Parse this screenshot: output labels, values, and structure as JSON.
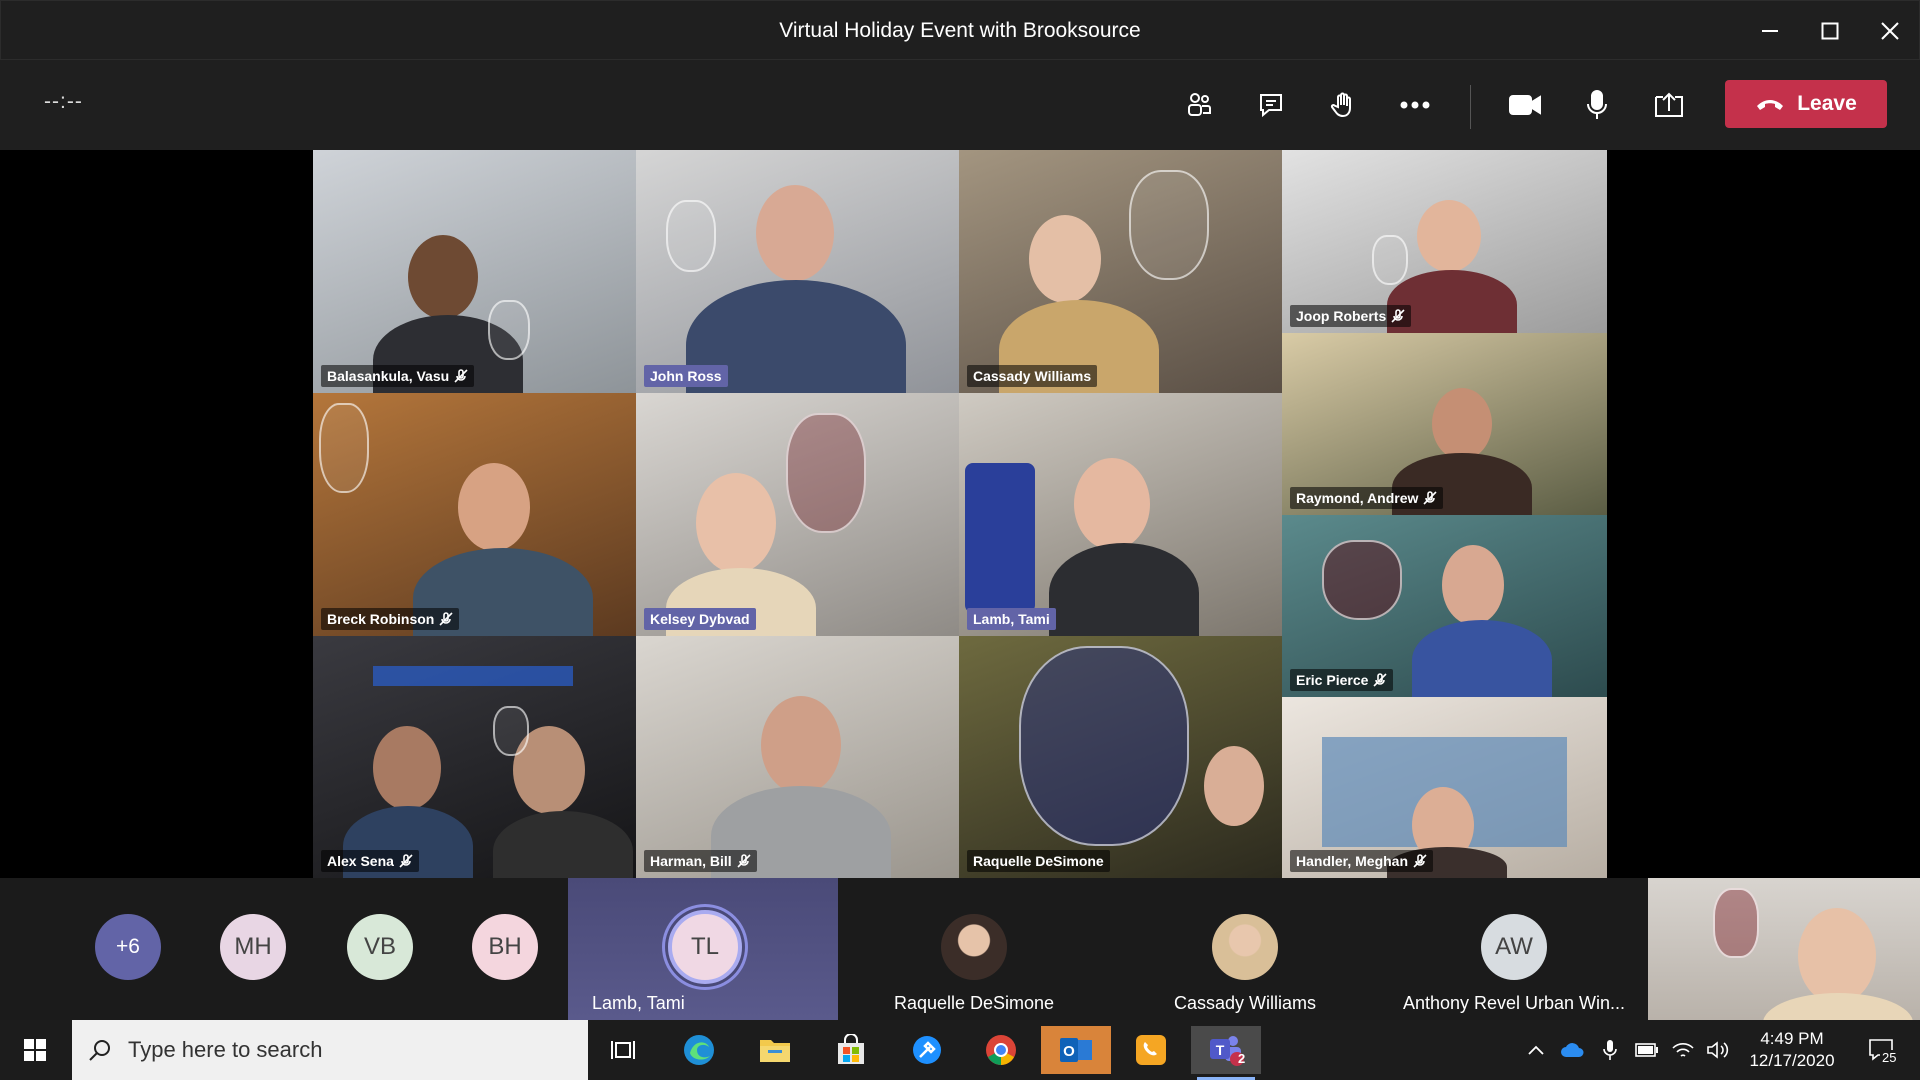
{
  "window": {
    "title": "Virtual Holiday Event with Brooksource"
  },
  "toolbar": {
    "timer": "--:--",
    "leave_label": "Leave"
  },
  "tiles": [
    {
      "name": "Balasankula, Vasu",
      "muted": true
    },
    {
      "name": "John Ross",
      "muted": false,
      "active": true
    },
    {
      "name": "Cassady Williams",
      "muted": false
    },
    {
      "name": "Joop Roberts",
      "muted": true
    },
    {
      "name": "Raymond, Andrew",
      "muted": true
    },
    {
      "name": "Breck Robinson",
      "muted": true
    },
    {
      "name": "Kelsey Dybvad",
      "muted": false,
      "active": true
    },
    {
      "name": "Lamb, Tami",
      "muted": false,
      "active": true
    },
    {
      "name": "Eric Pierce",
      "muted": true
    },
    {
      "name": "Alex Sena",
      "muted": true
    },
    {
      "name": "Harman, Bill",
      "muted": true
    },
    {
      "name": "Raquelle DeSimone",
      "muted": false
    },
    {
      "name": "Handler, Meghan",
      "muted": true
    }
  ],
  "roster": {
    "overflow": "+6",
    "avatars": [
      {
        "initials": "MH",
        "color": "#e8d6e4"
      },
      {
        "initials": "VB",
        "color": "#d8e8d8"
      },
      {
        "initials": "BH",
        "color": "#f4d6de"
      }
    ],
    "participants": [
      {
        "initials": "TL",
        "name": "Lamb, Tami",
        "speaking": true
      },
      {
        "initials": "",
        "name": "Raquelle DeSimone"
      },
      {
        "initials": "",
        "name": "Cassady Williams"
      },
      {
        "initials": "AW",
        "name": "Anthony Revel Urban Win..."
      }
    ]
  },
  "taskbar": {
    "search_placeholder": "Type here to search",
    "time": "4:49 PM",
    "date": "12/17/2020",
    "notifications": "25",
    "teams_badge": "2"
  },
  "colors": {
    "accent": "#6264a7",
    "leave": "#c4314b"
  }
}
